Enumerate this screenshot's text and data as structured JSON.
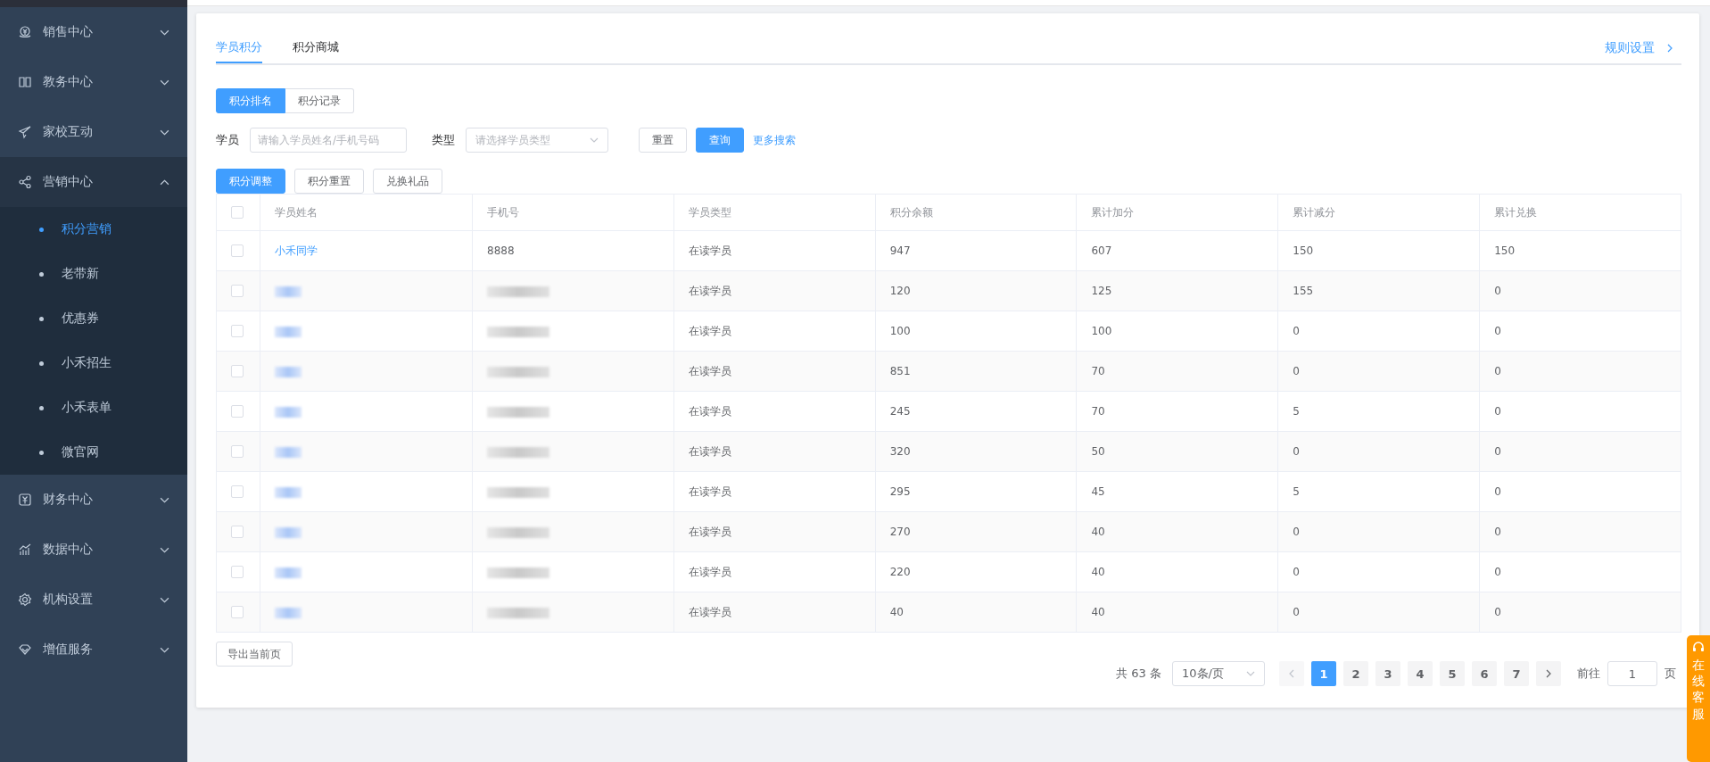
{
  "sidebar": {
    "items": [
      {
        "label": "销售中心",
        "expanded": false
      },
      {
        "label": "教务中心",
        "expanded": false
      },
      {
        "label": "家校互动",
        "expanded": false
      },
      {
        "label": "营销中心",
        "expanded": true,
        "children": [
          {
            "label": "积分营销",
            "selected": true
          },
          {
            "label": "老带新",
            "selected": false
          },
          {
            "label": "优惠券",
            "selected": false
          },
          {
            "label": "小禾招生",
            "selected": false
          },
          {
            "label": "小禾表单",
            "selected": false
          },
          {
            "label": "微官网",
            "selected": false
          }
        ]
      },
      {
        "label": "财务中心",
        "expanded": false
      },
      {
        "label": "数据中心",
        "expanded": false
      },
      {
        "label": "机构设置",
        "expanded": false
      },
      {
        "label": "增值服务",
        "expanded": false
      }
    ]
  },
  "tabs": [
    {
      "label": "学员积分",
      "selected": true
    },
    {
      "label": "积分商城",
      "selected": false
    }
  ],
  "rules_link": "规则设置",
  "segments": [
    {
      "label": "积分排名",
      "selected": true
    },
    {
      "label": "积分记录",
      "selected": false
    }
  ],
  "filters": {
    "student_label": "学员",
    "student_placeholder": "请输入学员姓名/手机号码",
    "type_label": "类型",
    "type_placeholder": "请选择学员类型",
    "reset": "重置",
    "query": "查询",
    "more": "更多搜索"
  },
  "actions": [
    {
      "label": "积分调整",
      "primary": true
    },
    {
      "label": "积分重置",
      "primary": false
    },
    {
      "label": "兑换礼品",
      "primary": false
    }
  ],
  "table": {
    "select_all_checked": false,
    "columns": [
      "学员姓名",
      "手机号",
      "学员类型",
      "积分余额",
      "累计加分",
      "累计减分",
      "累计兑换"
    ],
    "rows": [
      {
        "name": "小禾同学",
        "redacted": false,
        "checked": false,
        "phone": "8888",
        "type": "在读学员",
        "balance": "947",
        "added": "607",
        "deducted": "150",
        "exchanged": "150"
      },
      {
        "redacted": true,
        "checked": false,
        "type": "在读学员",
        "balance": "120",
        "added": "125",
        "deducted": "155",
        "exchanged": "0"
      },
      {
        "redacted": true,
        "checked": false,
        "type": "在读学员",
        "balance": "100",
        "added": "100",
        "deducted": "0",
        "exchanged": "0"
      },
      {
        "redacted": true,
        "checked": false,
        "type": "在读学员",
        "balance": "851",
        "added": "70",
        "deducted": "0",
        "exchanged": "0"
      },
      {
        "redacted": true,
        "checked": false,
        "type": "在读学员",
        "balance": "245",
        "added": "70",
        "deducted": "5",
        "exchanged": "0"
      },
      {
        "redacted": true,
        "checked": false,
        "type": "在读学员",
        "balance": "320",
        "added": "50",
        "deducted": "0",
        "exchanged": "0"
      },
      {
        "redacted": true,
        "checked": false,
        "type": "在读学员",
        "balance": "295",
        "added": "45",
        "deducted": "5",
        "exchanged": "0"
      },
      {
        "redacted": true,
        "checked": false,
        "type": "在读学员",
        "balance": "270",
        "added": "40",
        "deducted": "0",
        "exchanged": "0"
      },
      {
        "redacted": true,
        "checked": false,
        "type": "在读学员",
        "balance": "220",
        "added": "40",
        "deducted": "0",
        "exchanged": "0"
      },
      {
        "redacted": true,
        "checked": false,
        "type": "在读学员",
        "balance": "40",
        "added": "40",
        "deducted": "0",
        "exchanged": "0"
      }
    ]
  },
  "export": "导出当前页",
  "pagination": {
    "total": "共 63 条",
    "page_size": "10条/页",
    "pages": [
      {
        "label": "1",
        "selected": true
      },
      {
        "label": "2",
        "selected": false
      },
      {
        "label": "3",
        "selected": false
      },
      {
        "label": "4",
        "selected": false
      },
      {
        "label": "5",
        "selected": false
      },
      {
        "label": "6",
        "selected": false
      },
      {
        "label": "7",
        "selected": false
      }
    ],
    "goto_label": "前往",
    "goto_value": "1",
    "page_unit": "页"
  },
  "service": "在线客服"
}
